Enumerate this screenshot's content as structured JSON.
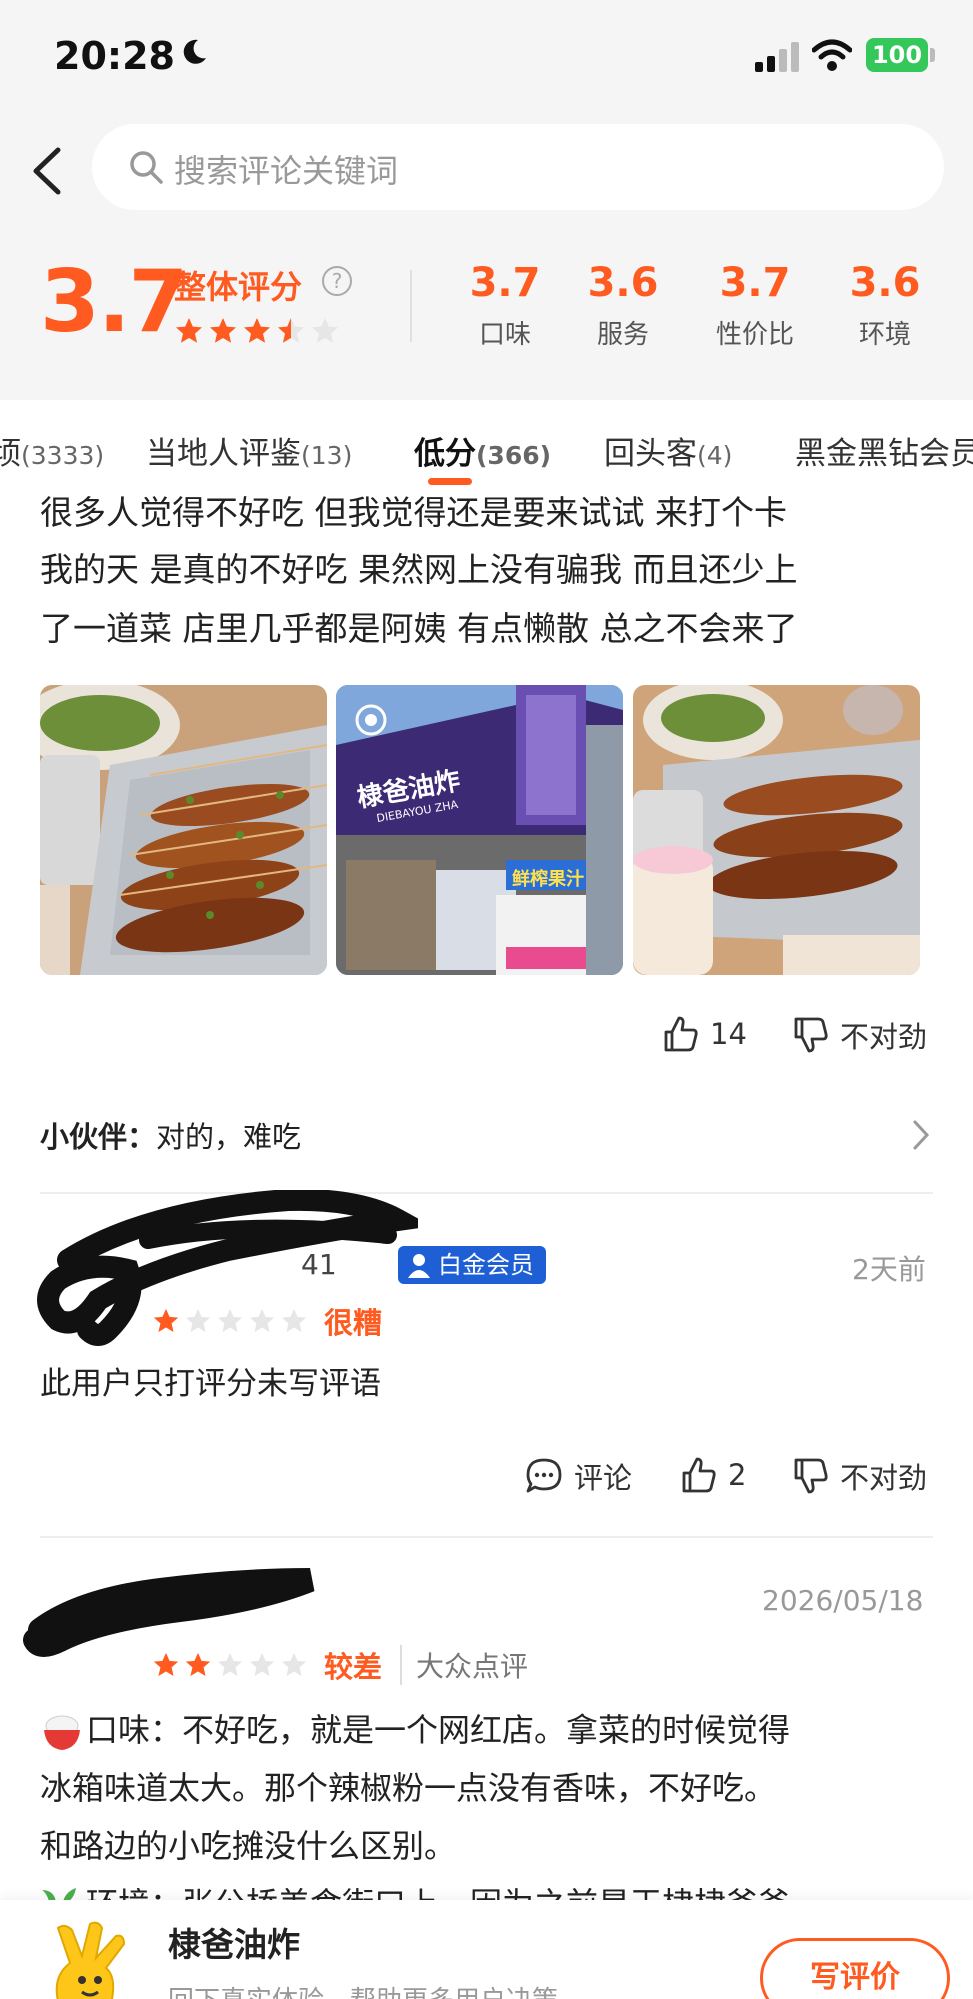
{
  "status_bar": {
    "time": "20:28",
    "battery": "100"
  },
  "search": {
    "placeholder": "搜索评论关键词"
  },
  "rating": {
    "overall": "3.7",
    "overall_label": "整体评分",
    "overall_stars": 3.5,
    "sub": [
      {
        "value": "3.7",
        "label": "口味"
      },
      {
        "value": "3.6",
        "label": "服务"
      },
      {
        "value": "3.7",
        "label": "性价比"
      },
      {
        "value": "3.6",
        "label": "环境"
      }
    ]
  },
  "tabs": [
    {
      "label": "顷",
      "count": "(3333)"
    },
    {
      "label": "当地人评鉴",
      "count": "(13)"
    },
    {
      "label": "低分",
      "count": "(366)"
    },
    {
      "label": "回头客",
      "count": "(4)"
    },
    {
      "label": "黑金黑钻会员",
      "count": ""
    }
  ],
  "active_tab": "低分",
  "review1": {
    "lines": [
      "很多人觉得不好吃 但我觉得还是要来试试 来打个卡",
      "我的天 是真的不好吃 果然网上没有骗我 而且还少上",
      "了一道菜 店里几乎都是阿姨 有点懒散 总之不会来了"
    ],
    "photo_sign": "棣爸油炸",
    "photo_sign_sub": "DIEBAYOU ZHA",
    "photo_juice_sign": "鲜榨果汁",
    "likes": "14",
    "dislike_label": "不对劲",
    "reply_name": "小伙伴：",
    "reply_text": "对的，难吃"
  },
  "review2": {
    "user_suffix": "41",
    "badge": "白金会员",
    "date": "2天前",
    "stars": 1,
    "rating_word": "很糟",
    "text": "此用户只打评分未写评语",
    "comment_label": "评论",
    "likes": "2",
    "dislike_label": "不对劲"
  },
  "review3": {
    "date": "2026/05/18",
    "stars": 2,
    "rating_word": "较差",
    "source": "大众点评",
    "lines": [
      "口味：不好吃，就是一个网红店。拿菜的时候觉得",
      "冰箱味道太大。那个辣椒粉一点没有香味，不好吃。",
      "和路边的小吃摊没什么区别。",
      "环境：张公桥美食街口上，因为之前是王棣棣爸爸"
    ]
  },
  "bottom_bar": {
    "shop_name": "棣爸油炸",
    "subtitle": "回下真实体验，帮助更多用户决策",
    "write_button": "写评价"
  },
  "colors": {
    "accent": "#ff5a1f",
    "badge_blue": "#1f5fd6",
    "battery_green": "#34c759"
  }
}
